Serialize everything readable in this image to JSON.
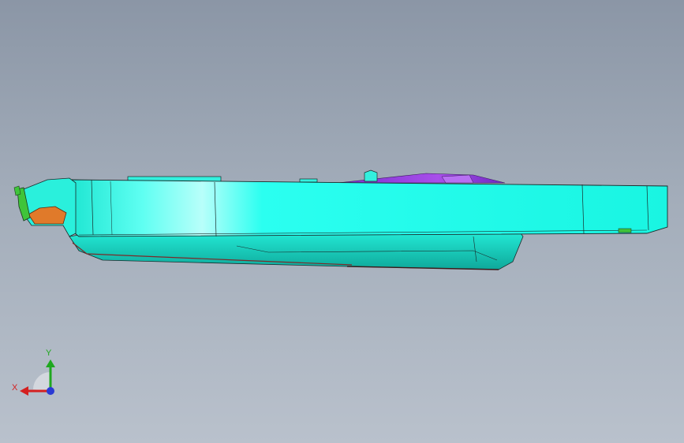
{
  "viewport": {
    "background_top": "#8b96a6",
    "background_bottom": "#b9c1cc"
  },
  "model": {
    "part_colors": {
      "body": "#19ffe6",
      "underside": "#12c9b7",
      "top_insert": "#9b3fe0",
      "end_cap_orange": "#e07a2a",
      "end_cap_green": "#3fc43a",
      "edge_lines": "#1a2a2a"
    }
  },
  "triad": {
    "x_label": "X",
    "y_label": "Y",
    "x_color": "#d42020",
    "y_color": "#1fa81f",
    "z_color": "#2a3ad4"
  }
}
